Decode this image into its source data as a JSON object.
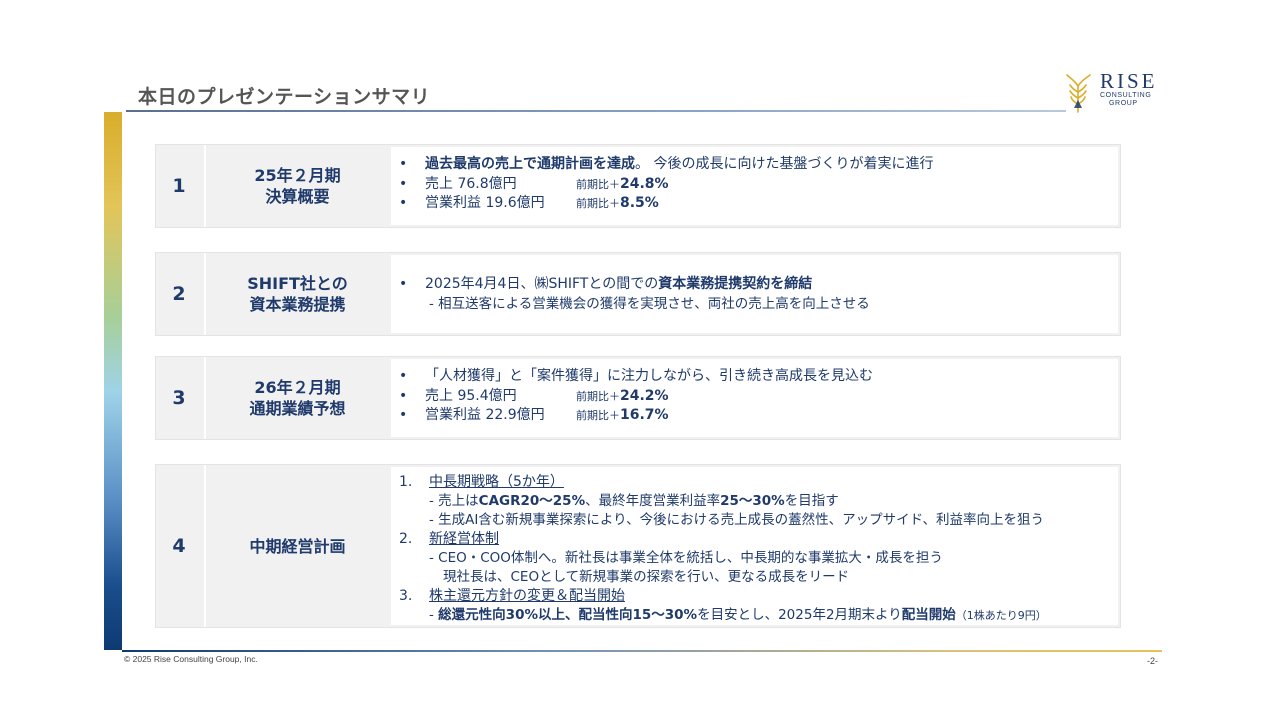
{
  "header": {
    "title": "本日のプレゼンテーションサマリ",
    "logo": {
      "name": "RISE",
      "sub1": "CONSULTING",
      "sub2": "GROUP",
      "icon": "wheat-icon",
      "color": "#d9ad2b"
    }
  },
  "rows": [
    {
      "num": "1",
      "label1": "25年２月期",
      "label2": "決算概要",
      "lines": [
        {
          "bold": "過去最高の売上で通期計画を達成",
          "rest": "。 今後の成長に向けた基盤づくりが着実に進行"
        },
        {
          "text": "売上 76.8億円",
          "yoy_label": "前期比＋",
          "yoy_value": "24.8%"
        },
        {
          "text": "営業利益 19.6億円",
          "yoy_label": "前期比＋",
          "yoy_value": "8.5%"
        }
      ]
    },
    {
      "num": "2",
      "label1": "SHIFT社との",
      "label2": "資本業務提携",
      "line1_a": "2025年4月4日、㈱SHIFTとの間での",
      "line1_b": "資本業務提携契約を締結",
      "sub": "- 相互送客による営業機会の獲得を実現させ、両社の売上高を向上させる"
    },
    {
      "num": "3",
      "label1": "26年２月期",
      "label2": "通期業績予想",
      "lines": [
        {
          "text": "「人材獲得」と「案件獲得」に注力しながら、引き続き高成長を見込む"
        },
        {
          "text": "売上 95.4億円",
          "yoy_label": "前期比＋",
          "yoy_value": "24.2%"
        },
        {
          "text": "営業利益 22.9億円",
          "yoy_label": "前期比＋",
          "yoy_value": "16.7%"
        }
      ]
    },
    {
      "num": "4",
      "label1": "中期経営計画",
      "items": [
        {
          "marker": "1.",
          "heading": "中長期戦略（5か年）",
          "sub1_a": "- 売上は",
          "sub1_b": "CAGR20～25%",
          "sub1_c": "、最終年度営業利益率",
          "sub1_d": "25～30%",
          "sub1_e": "を目指す",
          "sub2": "- 生成AI含む新規事業探索により、今後における売上成長の蓋然性、アップサイド、利益率向上を狙う"
        },
        {
          "marker": "2.",
          "heading": "新経営体制",
          "sub1": "- CEO・COO体制へ。新社長は事業全体を統括し、中長期的な事業拡大・成長を担う",
          "sub2": "現社長は、CEOとして新規事業の探索を行い、更なる成長をリード"
        },
        {
          "marker": "3.",
          "heading": "株主還元方針の変更＆配当開始",
          "sub1_a": "- ",
          "sub1_b": "総還元性向30%以上、配当性向15～30%",
          "sub1_c": "を目安とし、2025年2月期末より",
          "sub1_d": "配当開始",
          "sub1_e": "（1株あたり9円）"
        }
      ]
    }
  ],
  "footer": {
    "copyright": "© 2025 Rise Consulting Group, Inc.",
    "page": "-2-"
  },
  "colors": {
    "primary": "#1f3a6b",
    "accent": "#d9ad2b"
  }
}
